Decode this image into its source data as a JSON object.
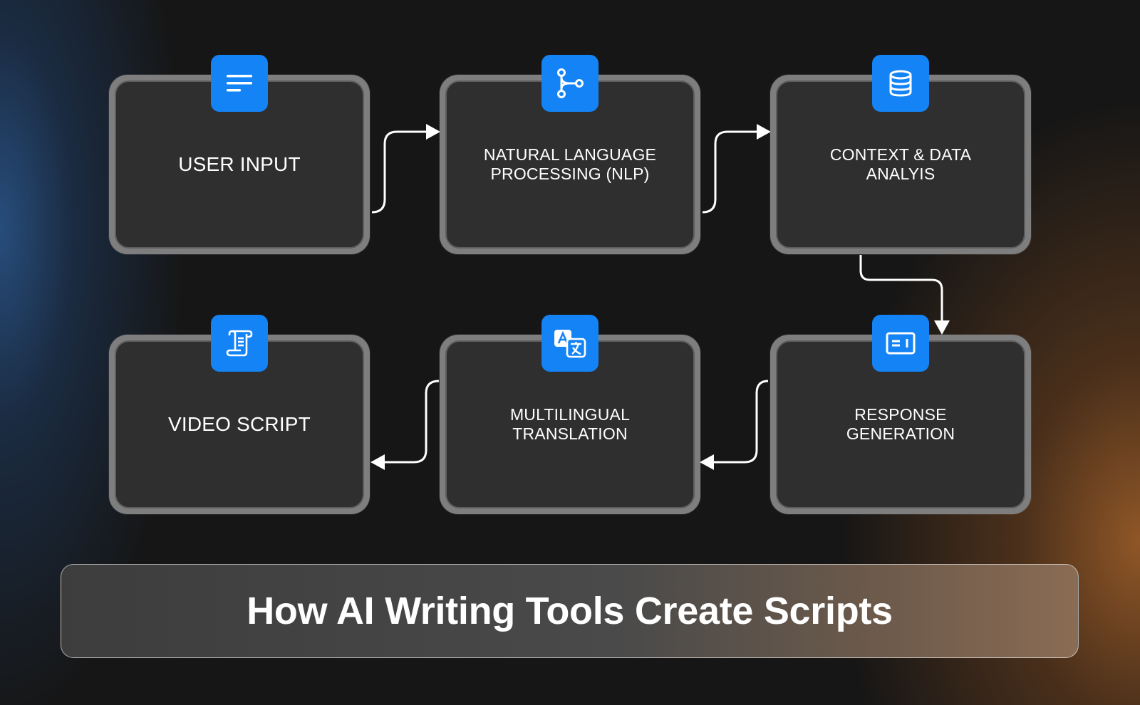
{
  "title": "How AI Writing Tools Create Scripts",
  "steps": [
    {
      "label": "USER INPUT",
      "icon": "text-lines-icon"
    },
    {
      "label": "NATURAL LANGUAGE PROCESSING (NLP)",
      "icon": "nodes-network-icon"
    },
    {
      "label": "CONTEXT & DATA ANALYIS",
      "icon": "database-icon"
    },
    {
      "label": "RESPONSE GENERATION",
      "icon": "text-box-icon"
    },
    {
      "label": "MULTILINGUAL TRANSLATION",
      "icon": "translate-icon"
    },
    {
      "label": "VIDEO SCRIPT",
      "icon": "scroll-document-icon"
    }
  ],
  "colors": {
    "background": "#161616",
    "card_frame": "#7e7e7e",
    "card_fill": "#2f2f2f",
    "icon_badge": "#1483f5",
    "text": "#ffffff",
    "accent_left_glow": "#285082",
    "accent_right_glow": "#965a28"
  }
}
